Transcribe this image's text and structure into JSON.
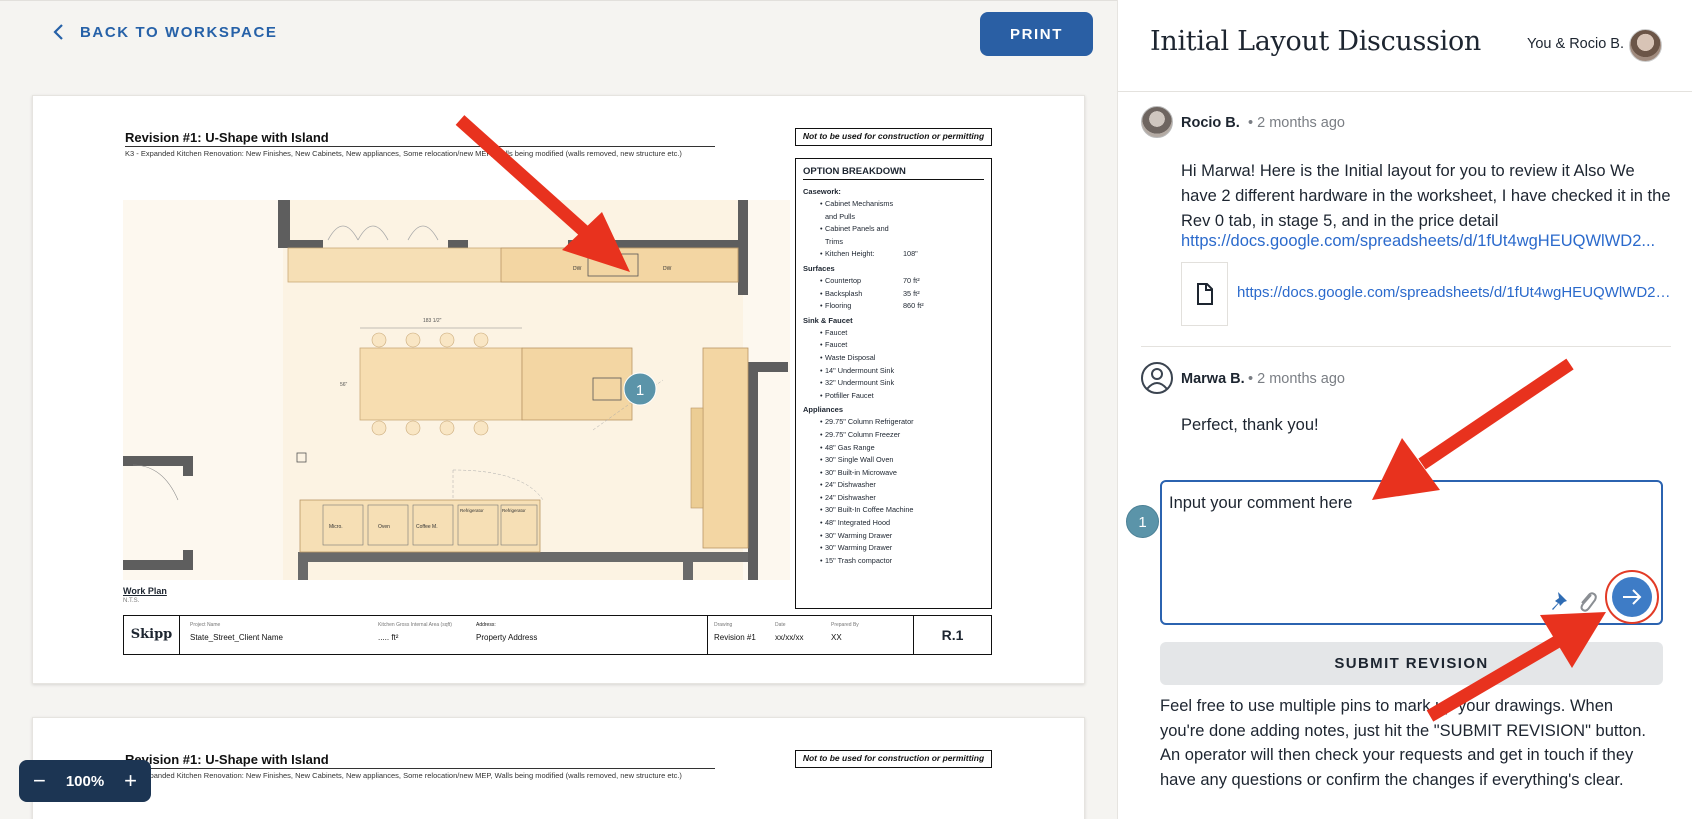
{
  "toolbar": {
    "back_label": "BACK TO WORKSPACE",
    "print_label": "PRINT"
  },
  "drawing": {
    "title": "Revision #1: U-Shape with Island",
    "subtitle": "K3 - Expanded Kitchen Renovation: New Finishes, New Cabinets, New appliances, Some relocation/new MEP, Walls being modified (walls removed, new structure etc.)",
    "warning": "Not to be used for construction or permitting",
    "pin_number": "1",
    "plan_labels": {
      "dw1": "DW",
      "dw2": "DW",
      "island_dim": "183 1/2\"",
      "island_depth": "56\"",
      "micro": "Micro.",
      "oven": "Oven",
      "coffee": "Coffee M.",
      "fridge1": "Refrigerator",
      "fridge2": "Refrigerator",
      "waste": "Waste"
    },
    "option_breakdown": {
      "title": "OPTION BREAKDOWN",
      "sections": [
        {
          "name": "Casework:",
          "items": [
            {
              "name": "Cabinet Mechanisms and Pulls",
              "value": ""
            },
            {
              "name": "Cabinet Panels and Trims",
              "value": ""
            },
            {
              "name": "Kitchen Height:",
              "value": "108\""
            }
          ]
        },
        {
          "name": "Surfaces",
          "items": [
            {
              "name": "Countertop",
              "value": "70 ft²"
            },
            {
              "name": "Backsplash",
              "value": "35 ft²"
            },
            {
              "name": "Flooring",
              "value": "860 ft²"
            }
          ]
        },
        {
          "name": "Sink & Faucet",
          "items": [
            {
              "name": "Faucet",
              "value": ""
            },
            {
              "name": "Faucet",
              "value": ""
            },
            {
              "name": "Waste Disposal",
              "value": ""
            },
            {
              "name": "14\" Undermount Sink",
              "value": ""
            },
            {
              "name": "32\" Undermount Sink",
              "value": ""
            },
            {
              "name": "Potfiller Faucet",
              "value": ""
            }
          ]
        },
        {
          "name": "Appliances",
          "items": [
            {
              "name": "29.75\" Column Refrigerator",
              "value": ""
            },
            {
              "name": "29.75\" Column Freezer",
              "value": ""
            },
            {
              "name": "48\" Gas Range",
              "value": ""
            },
            {
              "name": "30\" Single Wall Oven",
              "value": ""
            },
            {
              "name": "30\" Built-in Microwave",
              "value": ""
            },
            {
              "name": "24\" Dishwasher",
              "value": ""
            },
            {
              "name": "24\" Dishwasher",
              "value": ""
            },
            {
              "name": "30\" Built-In Coffee Machine",
              "value": ""
            },
            {
              "name": "48\" Integrated Hood",
              "value": ""
            },
            {
              "name": "30\" Warming Drawer",
              "value": ""
            },
            {
              "name": "30\" Warming Drawer",
              "value": ""
            },
            {
              "name": "15\" Trash compactor",
              "value": ""
            }
          ]
        }
      ]
    },
    "work_plan": "Work Plan",
    "nts": "N.T.S.",
    "title_block": {
      "logo": "Skipp",
      "project_label": "Project Name",
      "project_value": "State_Street_Client Name",
      "area_label": "Kitchen Gross Internal Area (sqft)",
      "area_value": "..... ft²",
      "address_label": "Address:",
      "address_value": "Property Address",
      "drawing_label": "Drawing",
      "drawing_value": "Revision #1",
      "date_label": "Date",
      "date_value": "xx/xx/xx",
      "prepared_label": "Prepared By",
      "prepared_value": "XX",
      "sheet": "R.1"
    }
  },
  "drawing2": {
    "title": "Revision #1: U-Shape with Island",
    "subtitle": "K3 - Expanded Kitchen Renovation: New Finishes, New Cabinets, New appliances, Some relocation/new MEP, Walls being modified (walls removed, new structure etc.)",
    "warning": "Not to be used for construction or permitting"
  },
  "zoom": {
    "minus": "−",
    "value": "100%",
    "plus": "+"
  },
  "discussion": {
    "title": "Initial Layout Discussion",
    "participants": "You & Rocio B.",
    "comments": [
      {
        "author": "Rocio B.",
        "time": "2 months ago",
        "body": "Hi Marwa! Here is the Initial layout for you to review it Also We have 2 different hardware in the worksheet, I have checked it in the Rev 0 tab, in stage 5, and in the price detail",
        "link": "https://docs.google.com/spreadsheets/d/1fUt4wgHEUQWlWD2...",
        "attachment": "https://docs.google.com/spreadsheets/d/1fUt4wgHEUQWlWD2v..."
      },
      {
        "author": "Marwa B.",
        "time": "2 months ago",
        "body": "Perfect, thank you!"
      }
    ],
    "pin_number": "1",
    "comment_value": "Input your comment here",
    "submit_label": "SUBMIT REVISION",
    "help_text": "Feel free to use multiple pins to mark up your drawings. When you're done adding notes, just hit the \"SUBMIT REVISION\" button. An operator will then check your requests and get in touch if they have any questions or confirm the changes if everything's clear.",
    "separator": "•"
  },
  "colors": {
    "accent": "#2a5fa4",
    "pin": "#5b94a9",
    "annotation_arrow": "#e8321e",
    "link": "#2b6acc"
  }
}
